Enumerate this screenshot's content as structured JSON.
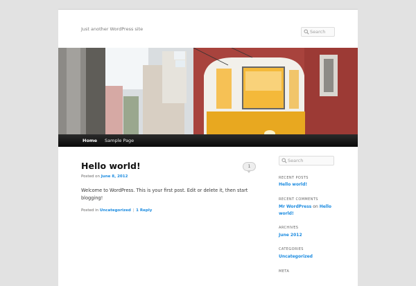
{
  "header": {
    "tagline": "Just another WordPress site",
    "search_placeholder": "Search"
  },
  "nav": {
    "items": [
      {
        "label": "Home"
      },
      {
        "label": "Sample Page"
      }
    ]
  },
  "post": {
    "title": "Hello world!",
    "comment_count": "1",
    "posted_on_label": "Posted on",
    "date": "June 8, 2012",
    "content": "Welcome to WordPress. This is your first post. Edit or delete it, then start blogging!",
    "posted_in_label": "Posted in",
    "category": "Uncategorized",
    "separator": "|",
    "replies": "1 Reply"
  },
  "sidebar": {
    "search_placeholder": "Search",
    "recent_posts_title": "RECENT POSTS",
    "recent_posts": [
      "Hello world!"
    ],
    "recent_comments_title": "RECENT COMMENTS",
    "recent_comment_author": "Mr WordPress",
    "recent_comment_on": "on",
    "recent_comment_post": "Hello world!",
    "archives_title": "ARCHIVES",
    "archives": [
      "June 2012"
    ],
    "categories_title": "CATEGORIES",
    "categories": [
      "Uncategorized"
    ],
    "meta_title": "META"
  },
  "colors": {
    "link": "#1b8be0",
    "nav_bg": "#111111",
    "page_bg": "#e2e2e2"
  }
}
